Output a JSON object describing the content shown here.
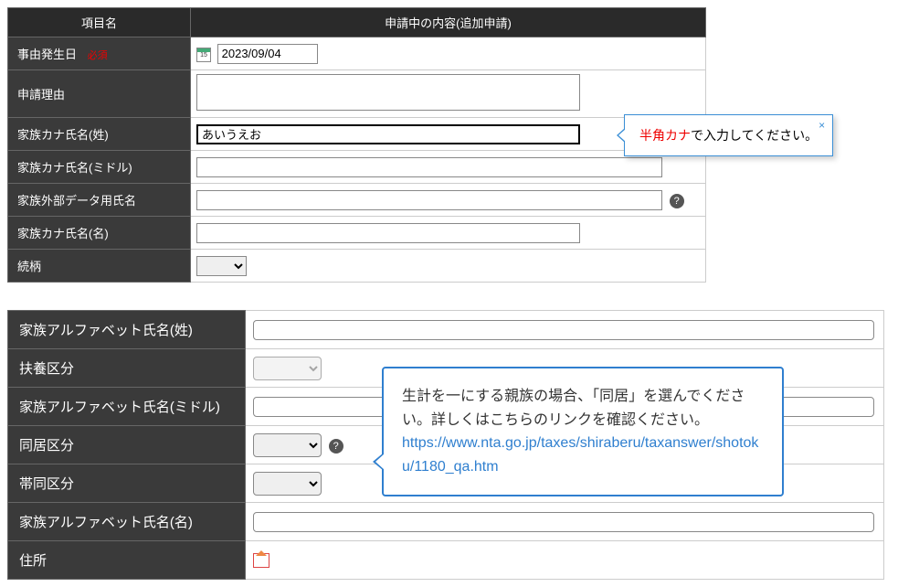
{
  "table1": {
    "header_col1": "項目名",
    "header_col2": "申請中の内容(追加申請)",
    "rows": {
      "date": {
        "label": "事由発生日",
        "required": "必須",
        "value": "2023/09/04"
      },
      "reason": {
        "label": "申請理由",
        "value": ""
      },
      "kana_sei": {
        "label": "家族カナ氏名(姓)",
        "value": "あいうえお"
      },
      "kana_mid": {
        "label": "家族カナ氏名(ミドル)",
        "value": ""
      },
      "ext_name": {
        "label": "家族外部データ用氏名",
        "value": ""
      },
      "kana_mei": {
        "label": "家族カナ氏名(名)",
        "value": ""
      },
      "relation": {
        "label": "続柄"
      }
    }
  },
  "tooltip1": {
    "highlight": "半角カナ",
    "rest": "で入力してください。"
  },
  "table2": {
    "rows": {
      "alpha_sei": {
        "label": "家族アルファベット氏名(姓)",
        "value": ""
      },
      "fuyo": {
        "label": "扶養区分"
      },
      "alpha_mid": {
        "label": "家族アルファベット氏名(ミドル)",
        "value": ""
      },
      "dokyo": {
        "label": "同居区分"
      },
      "taido": {
        "label": "帯同区分"
      },
      "alpha_mei": {
        "label": "家族アルファベット氏名(名)",
        "value": ""
      },
      "address": {
        "label": "住所"
      }
    }
  },
  "tooltip2": {
    "text": "生計を一にする親族の場合、「同居」を選んでください。詳しくはこちらのリンクを確認ください。",
    "link": "https://www.nta.go.jp/taxes/shiraberu/taxanswer/shotoku/1180_qa.htm"
  }
}
